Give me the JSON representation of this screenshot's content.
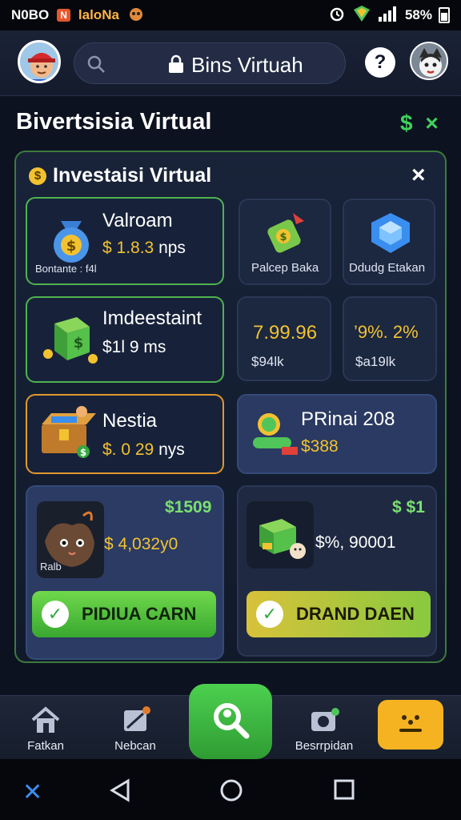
{
  "status_bar": {
    "time": "N0BO",
    "app_tag": "N",
    "carrier": "laloNa",
    "battery": "58%"
  },
  "header": {
    "title": "Bins Virtuah",
    "help_glyph": "?"
  },
  "section": {
    "title": "Bivertsisia Virtual",
    "dollar_icon": "$",
    "close_icon": "×"
  },
  "panel": {
    "title": "Investaisi Virtual",
    "close": "×",
    "cards": {
      "valroam": {
        "name": "Valroam",
        "price": "$ 1.8.3",
        "unit": "nps",
        "sub": "Bontante : f4l"
      },
      "palcep": {
        "label": "Palcep Baka"
      },
      "ddudg": {
        "label": "Ddudg Etakan"
      },
      "imdeestaint": {
        "name": "Imdeestaint",
        "price": "$1l 9",
        "unit": "ms"
      },
      "stat1": {
        "value": "7.99.96",
        "sub": "$94lk"
      },
      "stat2": {
        "value": "’9%. 2%",
        "sub": "$a19lk"
      },
      "nestia": {
        "name": "Nestia",
        "price": "$. 0 29",
        "unit": "nys"
      },
      "prinai": {
        "name": "PRinai 208",
        "price": "$388"
      },
      "pet": {
        "tag": "$1509",
        "value": "$ 4,032y0",
        "img_label": "Ralb",
        "button": "PIDIUA CARN"
      },
      "crate": {
        "tag": "$ $1",
        "value": "$%, 90001",
        "button": "DRAND DAEN"
      }
    }
  },
  "bottom_nav": {
    "home": "Fatkan",
    "news": "Nebcan",
    "camera": "Besrrpidan"
  },
  "colors": {
    "accent_green": "#3fd25c",
    "gold": "#f2c230",
    "panel_border": "#3d7a3d"
  }
}
